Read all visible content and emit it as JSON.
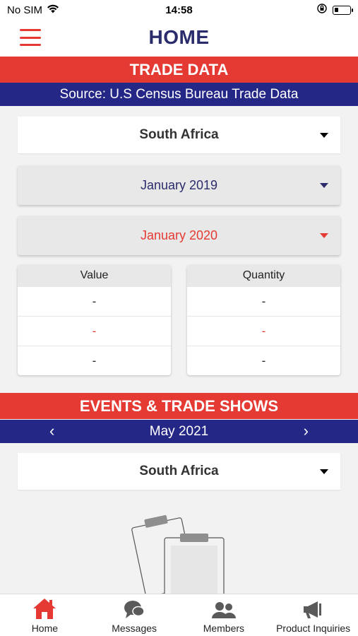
{
  "status_bar": {
    "carrier": "No SIM",
    "time": "14:58",
    "battery_level": 0.25
  },
  "nav": {
    "title": "HOME"
  },
  "trade": {
    "header": "TRADE DATA",
    "source": "Source: U.S Census Bureau Trade Data",
    "country": "South Africa",
    "start_date": "January 2019",
    "end_date": "January 2020",
    "value_header": "Value",
    "quantity_header": "Quantity",
    "value_rows": [
      "-",
      "-",
      "-"
    ],
    "quantity_rows": [
      "-",
      "-",
      "-"
    ]
  },
  "events": {
    "header": "EVENTS & TRADE SHOWS",
    "month": "May 2021",
    "prev_icon": "chevron-left-icon",
    "next_icon": "chevron-right-icon",
    "country": "South Africa"
  },
  "tabs": [
    {
      "label": "Home",
      "icon": "home-icon",
      "active": true
    },
    {
      "label": "Messages",
      "icon": "chat-icon"
    },
    {
      "label": "Members",
      "icon": "users-icon"
    },
    {
      "label": "Product Inquiries",
      "icon": "megaphone-icon"
    }
  ],
  "colors": {
    "accent_red": "#e53a33",
    "navy": "#252787",
    "title_navy": "#2b2c6b",
    "icon_grey": "#5a5a5a"
  }
}
